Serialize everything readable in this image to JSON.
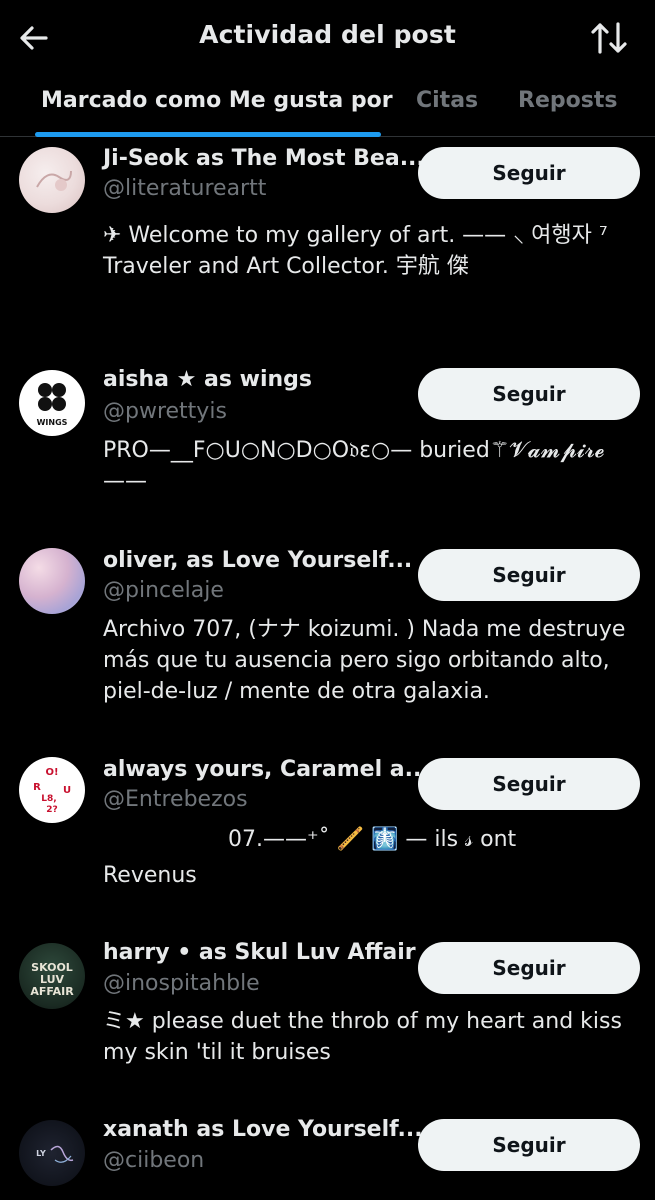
{
  "header": {
    "title": "Actividad del post",
    "back_icon": "arrow-left-icon",
    "sort_icon": "sort-arrows-icon"
  },
  "tabs": [
    {
      "label": "Marcado como Me gusta por",
      "active": true
    },
    {
      "label": "Citas",
      "active": false
    },
    {
      "label": "Reposts",
      "active": false
    }
  ],
  "accent": "#1d9bf0",
  "users": [
    {
      "name": "Ji-Seok as The Most Bea...",
      "handle": "@literatureartt",
      "bio": [
        "✈ Welcome to my gallery of art. —— ⸜ 여행자 ⁷",
        "Traveler and Art Collector. 宇航 傑"
      ],
      "follow_label": "Seguir"
    },
    {
      "name": "aisha ★ as wings",
      "handle": "@pwrettyis",
      "bio": [
        "PRO—__F○U○N○D○O𝔡ɛ○— buried⚚𝓥𝓪𝓶𝓹𝓲𝓻𝓮",
        "——"
      ],
      "follow_label": "Seguir"
    },
    {
      "name": "oliver, as Love Yourself...",
      "handle": "@pincelaje",
      "bio": [
        "Archivo 707, (ナナ koizumi. ) Nada me destruye",
        "más que tu ausencia pero sigo orbitando alto,",
        "piel-de-luz / mente de otra galaxia."
      ],
      "follow_label": "Seguir"
    },
    {
      "name": "always yours, Caramel a...",
      "handle": "@Entrebezos",
      "bio": [
        "07.——⁺˚ 🪈 🩻 — ils 𝓈 ont",
        "Revenus"
      ],
      "follow_label": "Seguir"
    },
    {
      "name": "harry • as Skul Luv Affair",
      "handle": "@inospitahble",
      "bio": [
        "ミ★ please duet the throb of my heart and kiss",
        "my skin 'til it bruises"
      ],
      "follow_label": "Seguir"
    },
    {
      "name": "xanath as Love Yourself...",
      "handle": "@ciibeon",
      "bio": [],
      "follow_label": "Seguir"
    }
  ],
  "avatar_text": {
    "wings": "WINGS",
    "ro": [
      "O!",
      "R",
      "U",
      "L8,",
      "2?"
    ],
    "skool": [
      "SKOOL",
      "LUV",
      "AFFAIR"
    ],
    "ly": "LY"
  }
}
